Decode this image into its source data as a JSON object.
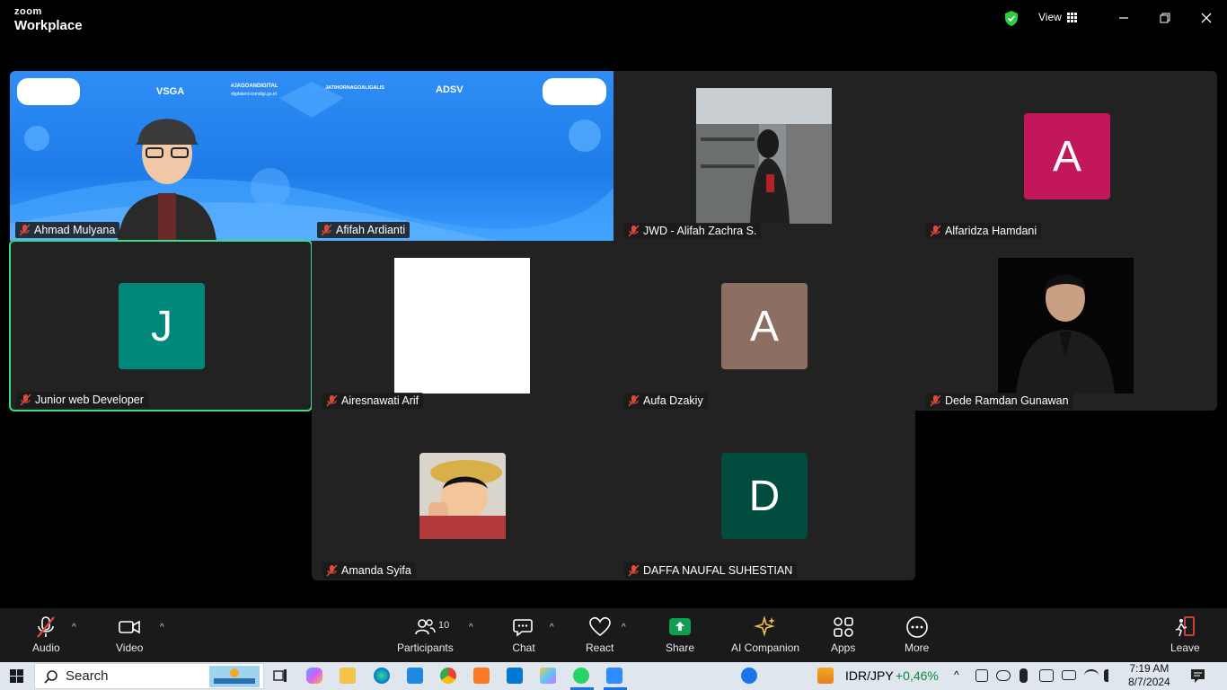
{
  "app": {
    "brand_small": "zoom",
    "brand_main": "Workplace",
    "view_label": "View"
  },
  "participants": [
    {
      "name": "Ahmad Mulyana",
      "kind": "slide",
      "color": "#1e7be8"
    },
    {
      "name": "Afifah Ardianti",
      "kind": "slide"
    },
    {
      "name": "JWD - Alifah Zachra S.",
      "kind": "photo"
    },
    {
      "name": "Alfaridza Hamdani",
      "kind": "avatar",
      "initial": "A",
      "color": "#c2185b"
    },
    {
      "name": "Junior web Developer",
      "kind": "avatar",
      "initial": "J",
      "color": "#00897b"
    },
    {
      "name": "Airesnawati Arif",
      "kind": "photo"
    },
    {
      "name": "Aufa Dzakiy",
      "kind": "avatar",
      "initial": "A",
      "color": "#8d6e63"
    },
    {
      "name": "Dede Ramdan Gunawan",
      "kind": "photo"
    },
    {
      "name": "Amanda Syifa",
      "kind": "photo"
    },
    {
      "name": "DAFFA NAUFAL SUHESTIAN",
      "kind": "avatar",
      "initial": "D",
      "color": "#004d40"
    }
  ],
  "slide": {
    "brand1": "VSGA",
    "hashtag": "#JAGOANDIGITAL",
    "link1": "digitalent.komdigi.go.id",
    "brand2": "JATIHORNAGOALIGALIS",
    "brand3": "ADSV"
  },
  "toolbar": {
    "audio": "Audio",
    "video": "Video",
    "participants": "Participants",
    "participants_count": "10",
    "chat": "Chat",
    "react": "React",
    "share": "Share",
    "ai": "AI Companion",
    "apps": "Apps",
    "more": "More",
    "leave": "Leave"
  },
  "taskbar": {
    "search": "Search",
    "ticker": "IDR/JPY",
    "ticker_change": "+0,46%",
    "time": "7:19 AM",
    "date": "8/7/2024"
  },
  "colors": {
    "accent_green": "#3ddc84",
    "share_green": "#0e9f50",
    "ticker_green": "#0b8a3a"
  }
}
